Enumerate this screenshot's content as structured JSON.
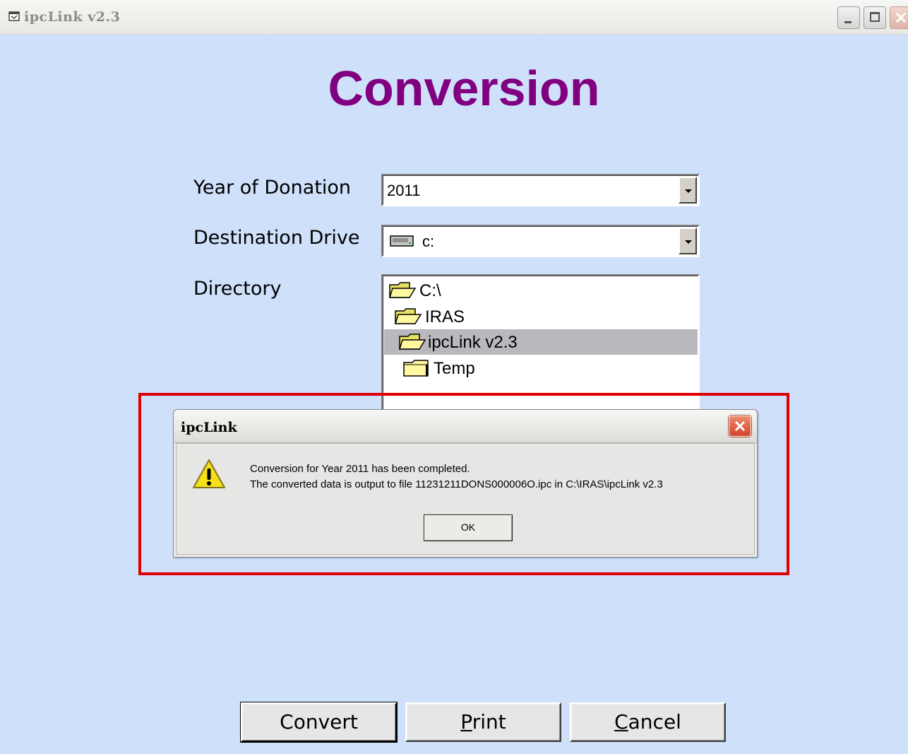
{
  "window": {
    "title": "ipcLink v2.3",
    "buttons": [
      "minimize",
      "maximize",
      "close"
    ]
  },
  "heading": "Conversion",
  "form": {
    "year_label": "Year of Donation",
    "year_value": "2011",
    "drive_label": "Destination Drive",
    "drive_value": "c:",
    "directory_label": "Directory",
    "directory_items": [
      {
        "label": "C:\\",
        "icon": "open-folder-icon",
        "selected": false
      },
      {
        "label": "IRAS",
        "icon": "open-folder-icon",
        "selected": false
      },
      {
        "label": "ipcLink v2.3",
        "icon": "open-folder-icon",
        "selected": true
      },
      {
        "label": "Temp",
        "icon": "closed-folder-icon",
        "selected": false
      }
    ]
  },
  "dialog": {
    "title": "ipcLink",
    "icon": "warning-icon",
    "message_line1": "Conversion for Year 2011 has been completed.",
    "message_line2": "The converted data is output to file 11231211DONS000006O.ipc in C:\\IRAS\\ipcLink v2.3",
    "ok_label": "OK"
  },
  "buttons": {
    "convert": "Convert",
    "print_underline": "P",
    "print_rest": "rint",
    "cancel_underline": "C",
    "cancel_rest": "ancel"
  },
  "colors": {
    "background": "#cfe0fb",
    "heading": "#800080",
    "highlight": "#e00000",
    "selection": "#b8b8be"
  }
}
